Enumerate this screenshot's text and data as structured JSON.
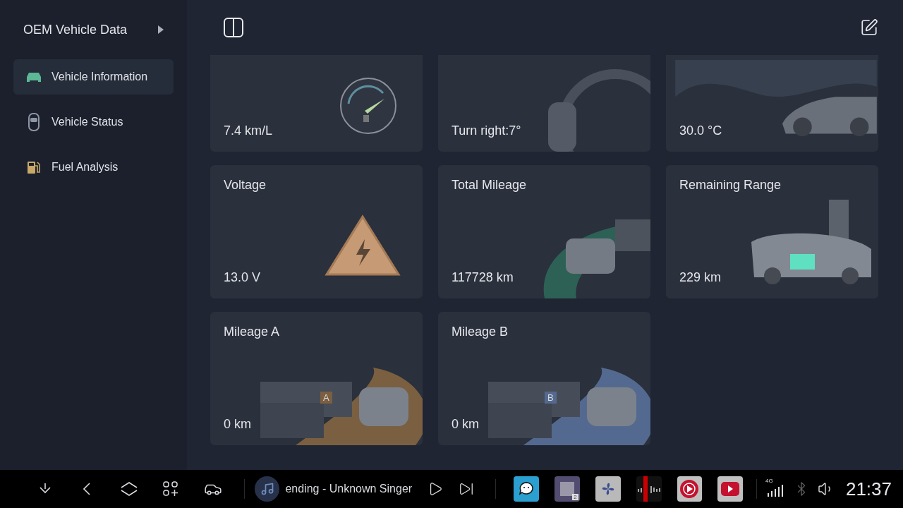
{
  "sidebar": {
    "title": "OEM Vehicle Data",
    "items": [
      {
        "label": "Vehicle Information",
        "kind": "car",
        "selected": true
      },
      {
        "label": "Vehicle Status",
        "kind": "top",
        "selected": false
      },
      {
        "label": "Fuel Analysis",
        "kind": "fuel",
        "selected": false
      }
    ]
  },
  "cards": [
    {
      "kind": "gauge",
      "value": "7.4 km/L"
    },
    {
      "kind": "steering",
      "value": "Turn right:7°"
    },
    {
      "kind": "scene",
      "value": "30.0 °C"
    },
    {
      "kind": "warning",
      "title": "Voltage",
      "value": "13.0 V"
    },
    {
      "kind": "curve",
      "title": "Total Mileage",
      "value": "117728 km"
    },
    {
      "kind": "charger",
      "title": "Remaining Range",
      "value": "229 km"
    },
    {
      "kind": "road",
      "title": "Mileage A",
      "value": "0 km",
      "sign": "A",
      "color": "#7a5f40"
    },
    {
      "kind": "road",
      "title": "Mileage B",
      "value": "0 km",
      "sign": "B",
      "color": "#54698f"
    }
  ],
  "taskbar": {
    "track": "ending - Unknown Singer",
    "apps": [
      {
        "kind": "waze"
      },
      {
        "kind": "window",
        "badge": "2"
      },
      {
        "kind": "fan"
      },
      {
        "kind": "radio"
      },
      {
        "kind": "music"
      },
      {
        "kind": "video"
      }
    ],
    "network": "4G",
    "time": "21:37"
  }
}
